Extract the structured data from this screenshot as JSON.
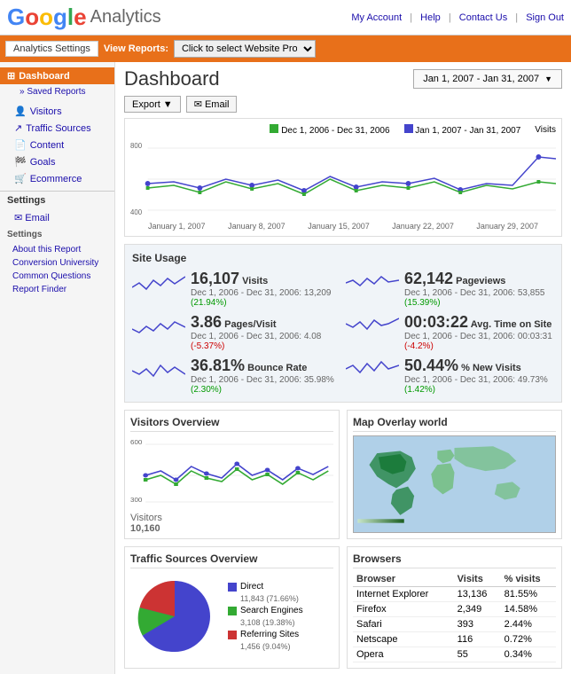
{
  "header": {
    "logo_google": "Google",
    "logo_analytics": "Analytics",
    "links": [
      "My Account",
      "Help",
      "Contact Us",
      "Sign Out"
    ]
  },
  "nav": {
    "analytics_settings": "Analytics Settings",
    "view_reports": "View Reports:",
    "select_profile_placeholder": "Click to select Website Profile"
  },
  "sidebar": {
    "dashboard_label": "Dashboard",
    "saved_reports": "» Saved Reports",
    "items": [
      {
        "label": "Visitors"
      },
      {
        "label": "Traffic Sources"
      },
      {
        "label": "Content"
      },
      {
        "label": "Goals"
      },
      {
        "label": "Ecommerce"
      }
    ],
    "settings_label": "Settings",
    "settings_email": "✉ Email",
    "settings_items": [
      {
        "label": "About this Report"
      },
      {
        "label": "Conversion University"
      },
      {
        "label": "Common Questions"
      },
      {
        "label": "Report Finder"
      }
    ]
  },
  "dashboard": {
    "title": "Dashboard",
    "date_range": "Jan 1, 2007 - Jan 31, 2007",
    "date_arrow": "▼",
    "export_label": "Export",
    "email_label": "✉ Email"
  },
  "chart_legend": [
    {
      "label": "Dec 1, 2006 - Dec 31, 2006",
      "color": "#3a3"
    },
    {
      "label": "Jan 1, 2007 - Jan 31, 2007",
      "color": "#4444cc"
    },
    {
      "label": "Visits",
      "color": ""
    }
  ],
  "chart_x_labels": [
    "January 1, 2007",
    "January 8, 2007",
    "January 15, 2007",
    "January 22, 2007",
    "January 29, 2007"
  ],
  "chart_y_labels": [
    "800",
    "400"
  ],
  "site_usage": {
    "title": "Site Usage",
    "stats": [
      {
        "value": "16,107",
        "label": "Visits",
        "sub": "Dec 1, 2006 - Dec 31, 2006: 13,209",
        "change": "(21.94%)",
        "change_dir": "up"
      },
      {
        "value": "62,142",
        "label": "Pageviews",
        "sub": "Dec 1, 2006 - Dec 31, 2006: 53,855",
        "change": "(15.39%)",
        "change_dir": "up"
      },
      {
        "value": "3.86",
        "label": "Pages/Visit",
        "sub": "Dec 1, 2006 - Dec 31, 2006: 4.08",
        "change": "(-5.37%)",
        "change_dir": "down"
      },
      {
        "value": "00:03:22",
        "label": "Avg. Time on Site",
        "sub": "Dec 1, 2006 - Dec 31, 2006: 00:03:31",
        "change": "(-4.2%)",
        "change_dir": "down"
      },
      {
        "value": "36.81%",
        "label": "Bounce Rate",
        "sub": "Dec 1, 2006 - Dec 31, 2006: 35.98%",
        "change": "(2.30%)",
        "change_dir": "up"
      },
      {
        "value": "50.44%",
        "label": "% New Visits",
        "sub": "Dec 1, 2006 - Dec 31, 2006: 49.73%",
        "change": "(1.42%)",
        "change_dir": "up"
      }
    ]
  },
  "visitors_overview": {
    "title": "Visitors Overview",
    "count_label": "Visitors",
    "count_value": "10,160",
    "y_labels": [
      "600",
      "300"
    ]
  },
  "map_overlay": {
    "title": "Map Overlay world"
  },
  "traffic_sources": {
    "title": "Traffic Sources Overview",
    "segments": [
      {
        "label": "Direct",
        "value": "11,843 (71.66%)",
        "color": "#4444cc"
      },
      {
        "label": "Search Engines",
        "value": "3,108 (19.38%)",
        "color": "#33aa33"
      },
      {
        "label": "Referring Sites",
        "value": "1,456 (9.04%)",
        "color": "#cc3333"
      }
    ]
  },
  "browsers": {
    "title": "Browsers",
    "columns": [
      "Browser",
      "Visits",
      "% visits"
    ],
    "rows": [
      {
        "browser": "Internet Explorer",
        "visits": "13,136",
        "pct": "81.55%"
      },
      {
        "browser": "Firefox",
        "visits": "2,349",
        "pct": "14.58%"
      },
      {
        "browser": "Safari",
        "visits": "393",
        "pct": "2.44%"
      },
      {
        "browser": "Netscape",
        "visits": "116",
        "pct": "0.72%"
      },
      {
        "browser": "Opera",
        "visits": "55",
        "pct": "0.34%"
      }
    ]
  }
}
